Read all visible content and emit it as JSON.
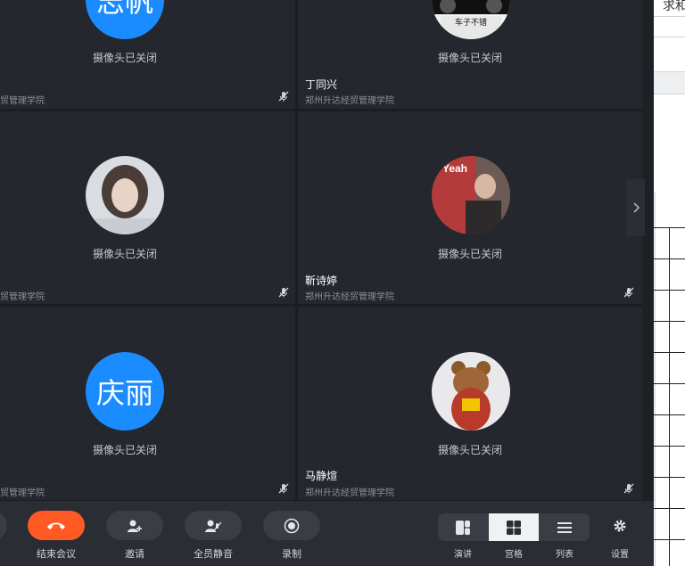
{
  "participants": [
    {
      "avatar_text": "志帆",
      "status": "摄像头已关闭",
      "name": "",
      "org": "经贸管理学院"
    },
    {
      "avatar_icon": "photo-avatar-icon",
      "status": "摄像头已关闭",
      "name": "丁同兴",
      "org": "郑州升达经贸管理学院"
    },
    {
      "avatar_icon": "photo-avatar-icon",
      "status": "摄像头已关闭",
      "name": "",
      "org": "经贸管理学院"
    },
    {
      "avatar_icon": "photo-avatar-icon",
      "status": "摄像头已关闭",
      "name": "靳诗婷",
      "org": "郑州升达经贸管理学院"
    },
    {
      "avatar_text": "庆丽",
      "status": "摄像头已关闭",
      "name": "",
      "org": "经贸管理学院"
    },
    {
      "avatar_icon": "photo-avatar-icon",
      "status": "摄像头已关闭",
      "name": "马静煊",
      "org": "郑州升达经贸管理学院"
    }
  ],
  "avatar_overlays": {
    "ding_caption": "车子不错",
    "jin_caption": "Yeah"
  },
  "right_panel": {
    "text": "求和"
  },
  "toolbar": {
    "end_label": "结束会议",
    "invite_label": "邀请",
    "mute_all_label": "全员静音",
    "record_label": "录制",
    "speaker_label": "演讲",
    "grid_label": "宫格",
    "list_label": "列表",
    "settings_label": "设置"
  },
  "colors": {
    "accent": "#1a8cff",
    "end_button": "#ff5a23",
    "tile_bg": "#24272d"
  }
}
